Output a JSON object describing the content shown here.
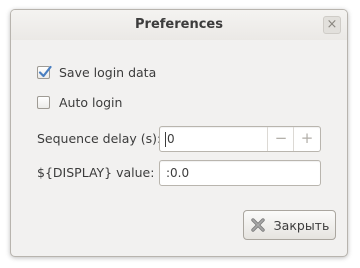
{
  "window": {
    "title": "Preferences",
    "close_glyph": "×"
  },
  "options": {
    "save_login": {
      "label": "Save login data",
      "checked": true
    },
    "auto_login": {
      "label": "Auto login",
      "checked": false
    }
  },
  "sequence_delay": {
    "label": "Sequence delay (s):",
    "value": "0",
    "decrement_glyph": "−",
    "increment_glyph": "+"
  },
  "display": {
    "label": "${DISPLAY} value:",
    "value": ":0.0"
  },
  "close_button": {
    "label": "Закрыть",
    "icon": "close-x-icon"
  },
  "colors": {
    "window_bg": "#f2f1f0",
    "check_blue": "#4a7fc1",
    "close_x_red": "#8e8e8e"
  }
}
